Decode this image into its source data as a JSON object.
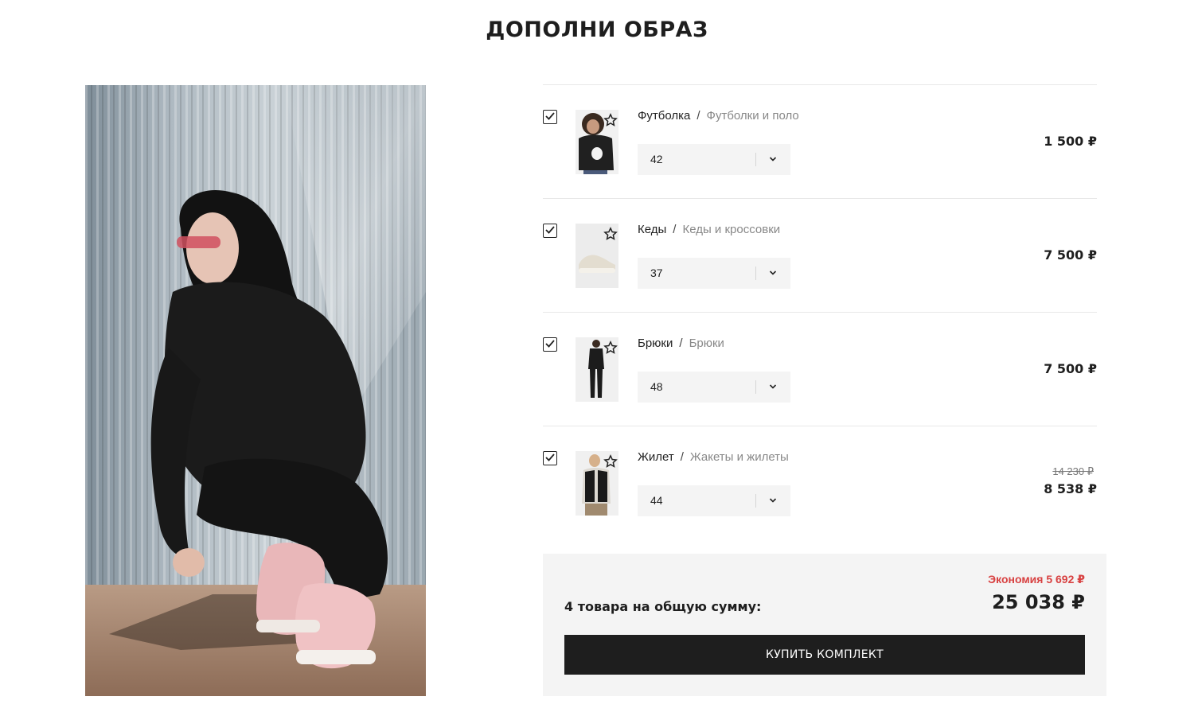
{
  "page": {
    "title": "ДОПОЛНИ ОБРАЗ"
  },
  "products": [
    {
      "name": "Футболка",
      "separator": "/",
      "category": "Футболки и поло",
      "size": "42",
      "price": "1 500 ₽",
      "checked": true,
      "thumb_icon": "tshirt-model-photo"
    },
    {
      "name": "Кеды",
      "separator": "/",
      "category": "Кеды и кроссовки",
      "size": "37",
      "price": "7 500 ₽",
      "checked": true,
      "thumb_icon": "sneakers-photo"
    },
    {
      "name": "Брюки",
      "separator": "/",
      "category": "Брюки",
      "size": "48",
      "price": "7 500 ₽",
      "checked": true,
      "thumb_icon": "pants-model-photo"
    },
    {
      "name": "Жилет",
      "separator": "/",
      "category": "Жакеты и жилеты",
      "size": "44",
      "price_old": "14 230 ₽",
      "price": "8 538 ₽",
      "checked": true,
      "thumb_icon": "vest-model-photo"
    }
  ],
  "summary": {
    "savings": "Экономия 5 692 ₽",
    "total_label": "4 товара на общую сумму:",
    "total_value": "25 038 ₽",
    "buy_label": "КУПИТЬ КОМПЛЕКТ"
  },
  "colors": {
    "accent_dark": "#1e1e1e",
    "savings_red": "#d84141",
    "panel_bg": "#f4f4f4"
  }
}
